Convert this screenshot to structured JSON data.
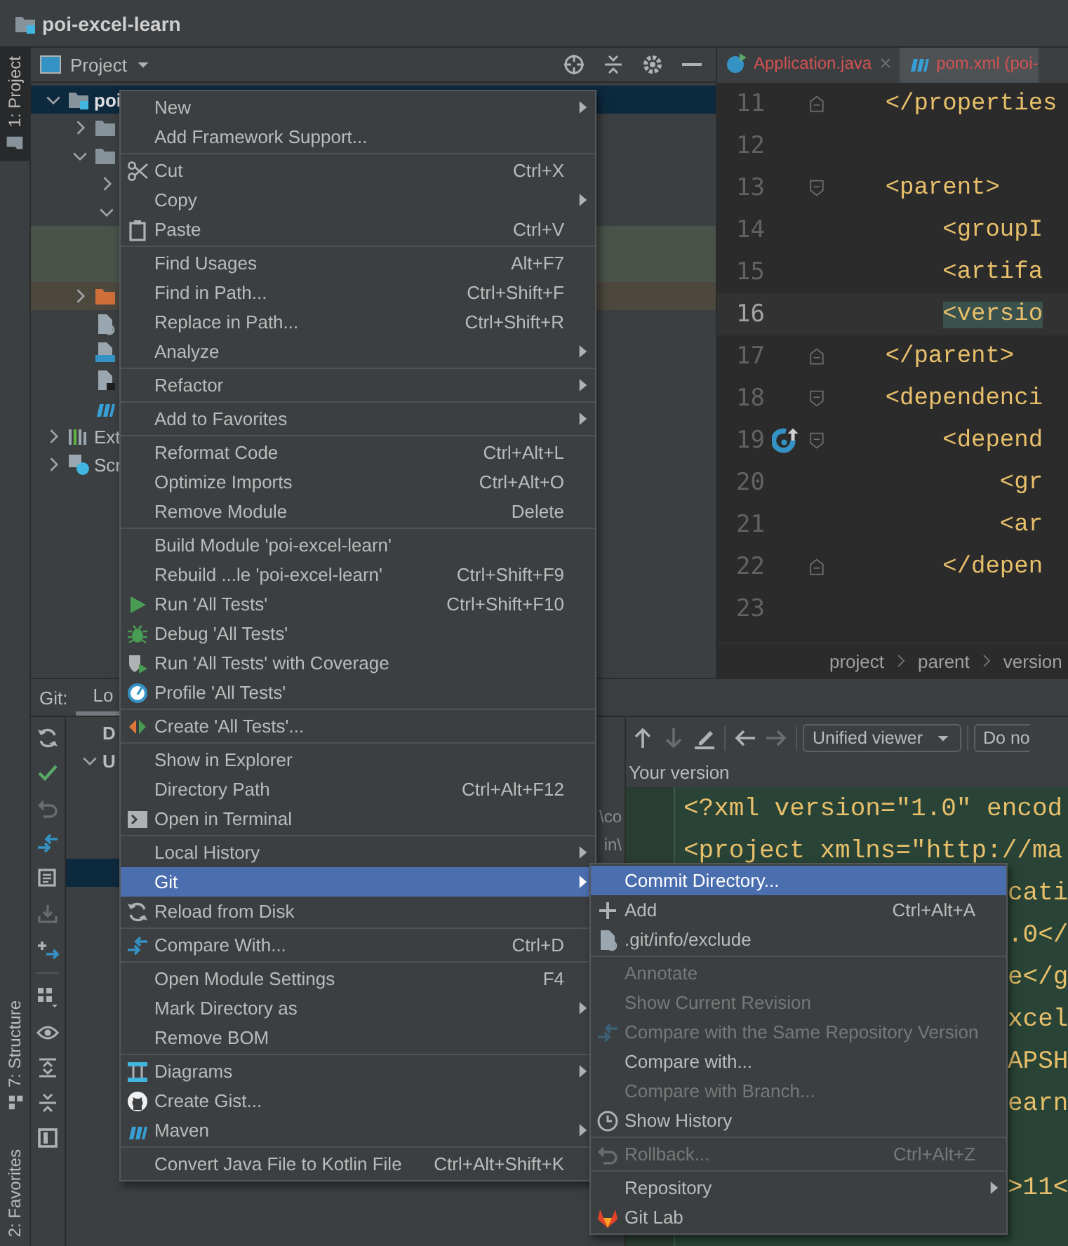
{
  "title_bar": {
    "project": "poi-excel-learn"
  },
  "tool_strip": [
    {
      "label": "1: Project",
      "selected": true,
      "kind": "folder"
    },
    {
      "label": "7: Structure",
      "selected": false,
      "kind": "structure"
    },
    {
      "label": "2: Favorites",
      "selected": false
    }
  ],
  "project_panel": {
    "title": "Project",
    "tree": [
      {
        "label": "poi",
        "kind": "module",
        "expanded": true,
        "selected": true,
        "children": [
          {
            "kind": "folder",
            "expanded": false,
            "selected": false
          },
          {
            "kind": "folder",
            "expanded": true,
            "selected": false,
            "children": [
              {
                "expanded": false,
                "selected": false
              },
              {
                "expanded": true,
                "selected": false,
                "children": [
                  {
                    "selected": false,
                    "color": "#49534a"
                  },
                  {
                    "selected": false,
                    "color": "#49534a"
                  }
                ]
              }
            ]
          },
          {
            "kind": "excluded",
            "expanded": false,
            "selected": false,
            "color": "#4c483e"
          },
          {
            "kind": "ignore",
            "selected": false
          },
          {
            "kind": "markdown",
            "selected": false
          },
          {
            "kind": "script",
            "selected": false
          },
          {
            "kind": "maven",
            "selected": false
          }
        ]
      },
      {
        "label": "Ext",
        "kind": "libraries",
        "expanded": false,
        "selected": false
      },
      {
        "label": "Scr",
        "kind": "scratches",
        "expanded": false,
        "selected": false
      }
    ]
  },
  "editor": {
    "tabs": [
      {
        "label": "Application.java",
        "kind": "java",
        "selected": false,
        "closable": true
      },
      {
        "label": "pom.xml (poi-",
        "kind": "maven",
        "selected": true,
        "closable": false
      }
    ],
    "lines": [
      {
        "number": "11",
        "text": "    </properties",
        "current": false,
        "kind": "close"
      },
      {
        "number": "12",
        "current": false,
        "kind": "plain"
      },
      {
        "number": "13",
        "text": "    <parent>",
        "current": false,
        "kind": "open"
      },
      {
        "number": "14",
        "text": "        <groupI",
        "current": false,
        "kind": "plain"
      },
      {
        "number": "15",
        "text": "        <artifa",
        "current": false,
        "kind": "plain"
      },
      {
        "number": "16",
        "text": "        <versio",
        "current": true,
        "matched": true,
        "kind": "plain"
      },
      {
        "number": "17",
        "text": "    </parent>",
        "current": false,
        "kind": "close"
      },
      {
        "number": "18",
        "text": "    <dependenci",
        "current": false,
        "kind": "open"
      },
      {
        "number": "19",
        "text": "        <depend",
        "current": false,
        "kind": "override"
      },
      {
        "number": "20",
        "text": "            <gr",
        "current": false,
        "kind": "plain"
      },
      {
        "number": "21",
        "text": "            <ar",
        "current": false,
        "kind": "plain"
      },
      {
        "number": "22",
        "text": "        </depen",
        "current": false,
        "kind": "close"
      },
      {
        "number": "23",
        "current": false,
        "kind": "plain"
      }
    ],
    "breadcrumb": [
      "project",
      "parent",
      "version"
    ]
  },
  "git_panel": {
    "label": "Git:",
    "tabs": [
      {
        "label": "Lo",
        "selected": true
      }
    ],
    "toolbar": [
      {
        "kind": "refresh",
        "disabled": false
      },
      {
        "kind": "check",
        "disabled": false
      },
      {
        "kind": "undo",
        "disabled": true
      },
      {
        "kind": "compare",
        "disabled": false
      },
      {
        "kind": "message",
        "disabled": false
      },
      {
        "kind": "download",
        "disabled": true
      },
      {
        "kind": "shelve",
        "disabled": false
      },
      {
        "kind": "group",
        "disabled": false
      },
      {
        "kind": "eye",
        "disabled": false
      },
      {
        "kind": "expand",
        "disabled": false
      },
      {
        "kind": "collapse",
        "disabled": false
      },
      {
        "kind": "preview",
        "disabled": false
      }
    ],
    "changes": [
      {
        "label": "D",
        "selected": false
      },
      {
        "label": "U",
        "expanded": true,
        "selected": false
      },
      {
        "selected": false
      },
      {
        "path": "\\co",
        "selected": false
      },
      {
        "path": "in\\",
        "selected": false
      },
      {
        "selected": true
      }
    ],
    "diff": {
      "toolbar": [
        {
          "kind": "up",
          "disabled": false
        },
        {
          "kind": "down",
          "disabled": true
        },
        {
          "kind": "pencil",
          "disabled": false
        },
        {
          "kind": "left",
          "disabled": false
        },
        {
          "kind": "right",
          "disabled": true
        }
      ],
      "viewer": "Unified viewer",
      "button": "Do no",
      "caption": "Your version",
      "lines": [
        {
          "kind": "full",
          "text": "<?xml version=\"1.0\" encod"
        },
        {
          "kind": "full",
          "text": "<project xmlns=\"http://ma"
        },
        {
          "kind": "tail",
          "text": "cati"
        },
        {
          "kind": "tail",
          "text": ".0</"
        },
        {
          "kind": "tail",
          "text": "e</g"
        },
        {
          "kind": "tail",
          "text": "xcel"
        },
        {
          "kind": "tail",
          "text": "APSH"
        },
        {
          "kind": "tail",
          "text": "earn"
        },
        {
          "kind": "tail"
        },
        {
          "kind": "tail",
          "text": ">11<"
        }
      ]
    }
  },
  "context_menu": {
    "groups": [
      [
        {
          "label": "New",
          "submenu": true,
          "selected": false
        },
        {
          "label": "Add Framework Support...",
          "submenu": false,
          "selected": false
        }
      ],
      [
        {
          "label": "Cut",
          "shortcut": "Ctrl+X",
          "kind": "scissors",
          "submenu": false,
          "selected": false
        },
        {
          "label": "Copy",
          "submenu": true,
          "selected": false
        },
        {
          "label": "Paste",
          "shortcut": "Ctrl+V",
          "kind": "clipboard",
          "submenu": false,
          "selected": false
        }
      ],
      [
        {
          "label": "Find Usages",
          "shortcut": "Alt+F7",
          "submenu": false,
          "selected": false
        },
        {
          "label": "Find in Path...",
          "shortcut": "Ctrl+Shift+F",
          "submenu": false,
          "selected": false
        },
        {
          "label": "Replace in Path...",
          "shortcut": "Ctrl+Shift+R",
          "submenu": false,
          "selected": false
        },
        {
          "label": "Analyze",
          "submenu": true,
          "selected": false
        }
      ],
      [
        {
          "label": "Refactor",
          "submenu": true,
          "selected": false
        }
      ],
      [
        {
          "label": "Add to Favorites",
          "submenu": true,
          "selected": false
        }
      ],
      [
        {
          "label": "Reformat Code",
          "shortcut": "Ctrl+Alt+L",
          "submenu": false,
          "selected": false
        },
        {
          "label": "Optimize Imports",
          "shortcut": "Ctrl+Alt+O",
          "submenu": false,
          "selected": false
        },
        {
          "label": "Remove Module",
          "shortcut": "Delete",
          "submenu": false,
          "selected": false
        }
      ],
      [
        {
          "label": "Build Module 'poi-excel-learn'",
          "submenu": false,
          "selected": false
        },
        {
          "label": "Rebuild ...le 'poi-excel-learn'",
          "shortcut": "Ctrl+Shift+F9",
          "submenu": false,
          "selected": false
        },
        {
          "label": "Run 'All Tests'",
          "shortcut": "Ctrl+Shift+F10",
          "kind": "run",
          "submenu": false,
          "selected": false
        },
        {
          "label": "Debug 'All Tests'",
          "kind": "bug",
          "submenu": false,
          "selected": false
        },
        {
          "label": "Run 'All Tests' with Coverage",
          "kind": "coverage",
          "submenu": false,
          "selected": false
        },
        {
          "label": "Profile 'All Tests'",
          "kind": "profile",
          "submenu": false,
          "selected": false
        }
      ],
      [
        {
          "label": "Create 'All Tests'...",
          "kind": "test",
          "submenu": false,
          "selected": false
        }
      ],
      [
        {
          "label": "Show in Explorer",
          "submenu": false,
          "selected": false
        },
        {
          "label": "Directory Path",
          "shortcut": "Ctrl+Alt+F12",
          "submenu": false,
          "selected": false
        },
        {
          "label": "Open in Terminal",
          "kind": "terminal",
          "submenu": false,
          "selected": false
        }
      ],
      [
        {
          "label": "Local History",
          "submenu": true,
          "selected": false
        },
        {
          "label": "Git",
          "submenu": true,
          "selected": true
        },
        {
          "label": "Reload from Disk",
          "kind": "refresh",
          "submenu": false,
          "selected": false
        }
      ],
      [
        {
          "label": "Compare With...",
          "shortcut": "Ctrl+D",
          "kind": "compare",
          "submenu": false,
          "selected": false
        }
      ],
      [
        {
          "label": "Open Module Settings",
          "shortcut": "F4",
          "submenu": false,
          "selected": false
        },
        {
          "label": "Mark Directory as",
          "submenu": true,
          "selected": false
        },
        {
          "label": "Remove BOM",
          "submenu": false,
          "selected": false
        }
      ],
      [
        {
          "label": "Diagrams",
          "kind": "diagram",
          "submenu": true,
          "selected": false
        },
        {
          "label": "Create Gist...",
          "kind": "cat",
          "submenu": false,
          "selected": false
        },
        {
          "label": "Maven",
          "kind": "maven",
          "submenu": true,
          "selected": false
        }
      ],
      [
        {
          "label": "Convert Java File to Kotlin File",
          "shortcut": "Ctrl+Alt+Shift+K",
          "submenu": false,
          "selected": false
        }
      ]
    ]
  },
  "git_submenu": {
    "groups": [
      [
        {
          "label": "Commit Directory...",
          "submenu": false,
          "selected": true,
          "disabled": false
        },
        {
          "label": "Add",
          "shortcut": "Ctrl+Alt+A",
          "kind": "plus",
          "submenu": false,
          "selected": false,
          "disabled": false
        },
        {
          "label": ".git/info/exclude",
          "kind": "ignore",
          "submenu": false,
          "selected": false,
          "disabled": false
        }
      ],
      [
        {
          "label": "Annotate",
          "submenu": false,
          "selected": false,
          "disabled": true
        },
        {
          "label": "Show Current Revision",
          "submenu": false,
          "selected": false,
          "disabled": true
        },
        {
          "label": "Compare with the Same Repository Version",
          "kind": "compare",
          "submenu": false,
          "selected": false,
          "disabled": true
        },
        {
          "label": "Compare with...",
          "submenu": false,
          "selected": false,
          "disabled": false
        },
        {
          "label": "Compare with Branch...",
          "submenu": false,
          "selected": false,
          "disabled": true
        },
        {
          "label": "Show History",
          "kind": "clock",
          "submenu": false,
          "selected": false,
          "disabled": false
        }
      ],
      [
        {
          "label": "Rollback...",
          "shortcut": "Ctrl+Alt+Z",
          "kind": "undo",
          "submenu": false,
          "selected": false,
          "disabled": true
        }
      ],
      [
        {
          "label": "Repository",
          "submenu": true,
          "selected": false,
          "disabled": false
        },
        {
          "label": "Git Lab",
          "kind": "fox",
          "submenu": false,
          "selected": false,
          "disabled": false
        }
      ]
    ]
  }
}
